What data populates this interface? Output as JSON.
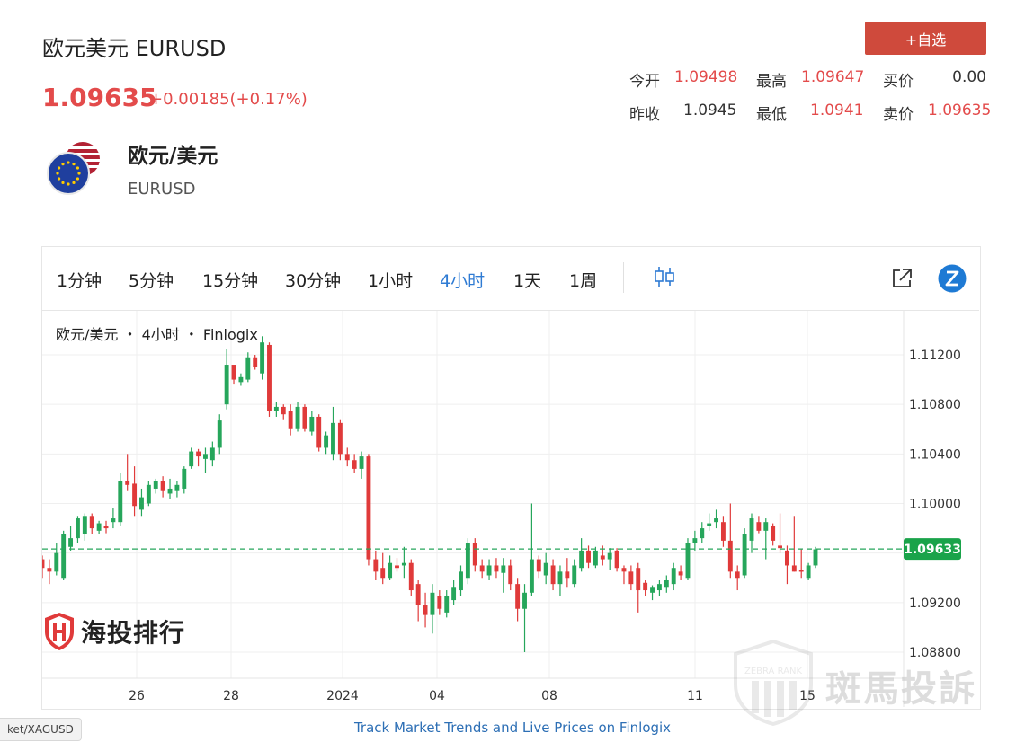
{
  "header": {
    "title": "欧元美元 EURUSD",
    "price": "1.09635",
    "change": "+0.00185(+0.17%)",
    "add_watchlist_label": "+自选"
  },
  "quote": {
    "open_label": "今开",
    "open_value": "1.09498",
    "high_label": "最高",
    "high_value": "1.09647",
    "bid_label": "买价",
    "bid_value": "0.00",
    "prev_close_label": "昨收",
    "prev_close_value": "1.0945",
    "low_label": "最低",
    "low_value": "1.0941",
    "ask_label": "卖价",
    "ask_value": "1.09635"
  },
  "instrument": {
    "name": "欧元/美元",
    "code": "EURUSD"
  },
  "toolbar": {
    "timeframes": [
      "1分钟",
      "5分钟",
      "15分钟",
      "30分钟",
      "1小时",
      "4小时",
      "1天",
      "1周"
    ],
    "active_timeframe": "4小时"
  },
  "chart_caption": "欧元/美元 ・ 4小时 ・ Finlogix",
  "watermark_left": "海投排行",
  "watermark_right": "斑馬投訴",
  "watermark_badge": "ZEBRA RANK",
  "footer_link": "Track Market Trends and Live Prices on Finlogix",
  "corner_tag": "ket/XAGUSD",
  "colors": {
    "up": "#26a65b",
    "down": "#e03a3a",
    "accent": "#2f7bd3",
    "price_red": "#e34b4b"
  },
  "chart_data": {
    "type": "candlestick",
    "title": "欧元/美元 ・ 4小时 ・ Finlogix",
    "x_tick_labels": [
      "26",
      "28",
      "2024",
      "04",
      "08",
      "11",
      "15"
    ],
    "y_tick_labels": [
      "1.11200",
      "1.10800",
      "1.10400",
      "1.10000",
      "1.09600",
      "1.09200",
      "1.08800"
    ],
    "y_ticks": [
      1.112,
      1.108,
      1.104,
      1.1,
      1.096,
      1.092,
      1.088
    ],
    "ylim": [
      1.0862,
      1.1175
    ],
    "last_price": 1.09633,
    "last_price_label": "1.09633",
    "grid": true,
    "candles": [
      {
        "o": 1.0955,
        "h": 1.0958,
        "l": 1.094,
        "c": 1.0948
      },
      {
        "o": 1.0948,
        "h": 1.0955,
        "l": 1.0935,
        "c": 1.0945
      },
      {
        "o": 1.0945,
        "h": 1.0968,
        "l": 1.0942,
        "c": 1.096
      },
      {
        "o": 1.094,
        "h": 1.0978,
        "l": 1.0938,
        "c": 1.0975
      },
      {
        "o": 1.0965,
        "h": 1.0982,
        "l": 1.0962,
        "c": 1.0972
      },
      {
        "o": 1.0972,
        "h": 1.099,
        "l": 1.0968,
        "c": 1.0988
      },
      {
        "o": 1.0975,
        "h": 1.0992,
        "l": 1.097,
        "c": 1.099
      },
      {
        "o": 1.099,
        "h": 1.0992,
        "l": 1.0975,
        "c": 1.098
      },
      {
        "o": 1.0978,
        "h": 1.0986,
        "l": 1.0975,
        "c": 1.0984
      },
      {
        "o": 1.0982,
        "h": 1.0986,
        "l": 1.0976,
        "c": 1.098
      },
      {
        "o": 1.0985,
        "h": 1.0996,
        "l": 1.098,
        "c": 1.0988
      },
      {
        "o": 1.0985,
        "h": 1.1025,
        "l": 1.0982,
        "c": 1.1018
      },
      {
        "o": 1.1018,
        "h": 1.104,
        "l": 1.101,
        "c": 1.1015
      },
      {
        "o": 1.1016,
        "h": 1.103,
        "l": 1.099,
        "c": 1.0998
      },
      {
        "o": 1.0995,
        "h": 1.1012,
        "l": 1.099,
        "c": 1.1005
      },
      {
        "o": 1.1,
        "h": 1.1018,
        "l": 1.0998,
        "c": 1.1015
      },
      {
        "o": 1.1012,
        "h": 1.102,
        "l": 1.1008,
        "c": 1.1018
      },
      {
        "o": 1.1018,
        "h": 1.1022,
        "l": 1.1005,
        "c": 1.101
      },
      {
        "o": 1.1008,
        "h": 1.102,
        "l": 1.1004,
        "c": 1.1012
      },
      {
        "o": 1.101,
        "h": 1.1018,
        "l": 1.1005,
        "c": 1.1015
      },
      {
        "o": 1.1012,
        "h": 1.103,
        "l": 1.1008,
        "c": 1.1028
      },
      {
        "o": 1.103,
        "h": 1.1045,
        "l": 1.1028,
        "c": 1.1042
      },
      {
        "o": 1.1042,
        "h": 1.1044,
        "l": 1.103,
        "c": 1.1038
      },
      {
        "o": 1.1036,
        "h": 1.1045,
        "l": 1.1025,
        "c": 1.104
      },
      {
        "o": 1.1035,
        "h": 1.105,
        "l": 1.103,
        "c": 1.1045
      },
      {
        "o": 1.1045,
        "h": 1.1072,
        "l": 1.104,
        "c": 1.1067
      },
      {
        "o": 1.108,
        "h": 1.1125,
        "l": 1.1076,
        "c": 1.1112
      },
      {
        "o": 1.1112,
        "h": 1.111,
        "l": 1.1096,
        "c": 1.11
      },
      {
        "o": 1.1098,
        "h": 1.1105,
        "l": 1.1095,
        "c": 1.1102
      },
      {
        "o": 1.11,
        "h": 1.1122,
        "l": 1.1098,
        "c": 1.1118
      },
      {
        "o": 1.1118,
        "h": 1.112,
        "l": 1.1108,
        "c": 1.111
      },
      {
        "o": 1.1105,
        "h": 1.1135,
        "l": 1.11,
        "c": 1.113
      },
      {
        "o": 1.1128,
        "h": 1.113,
        "l": 1.107,
        "c": 1.1075
      },
      {
        "o": 1.1075,
        "h": 1.1082,
        "l": 1.107,
        "c": 1.1078
      },
      {
        "o": 1.1078,
        "h": 1.108,
        "l": 1.1068,
        "c": 1.1072
      },
      {
        "o": 1.1075,
        "h": 1.108,
        "l": 1.1055,
        "c": 1.106
      },
      {
        "o": 1.106,
        "h": 1.1082,
        "l": 1.1058,
        "c": 1.1078
      },
      {
        "o": 1.1078,
        "h": 1.108,
        "l": 1.1058,
        "c": 1.106
      },
      {
        "o": 1.1058,
        "h": 1.1075,
        "l": 1.1055,
        "c": 1.107
      },
      {
        "o": 1.107,
        "h": 1.1072,
        "l": 1.1042,
        "c": 1.1045
      },
      {
        "o": 1.1045,
        "h": 1.1058,
        "l": 1.104,
        "c": 1.1055
      },
      {
        "o": 1.104,
        "h": 1.1078,
        "l": 1.1035,
        "c": 1.1065
      },
      {
        "o": 1.1065,
        "h": 1.1068,
        "l": 1.1035,
        "c": 1.104
      },
      {
        "o": 1.104,
        "h": 1.1045,
        "l": 1.103,
        "c": 1.1035
      },
      {
        "o": 1.1035,
        "h": 1.104,
        "l": 1.1025,
        "c": 1.1028
      },
      {
        "o": 1.1028,
        "h": 1.1042,
        "l": 1.102,
        "c": 1.1038
      },
      {
        "o": 1.1038,
        "h": 1.104,
        "l": 1.095,
        "c": 1.0955
      },
      {
        "o": 1.0955,
        "h": 1.0962,
        "l": 1.0938,
        "c": 1.0945
      },
      {
        "o": 1.0948,
        "h": 1.096,
        "l": 1.0935,
        "c": 1.094
      },
      {
        "o": 1.094,
        "h": 1.0958,
        "l": 1.0938,
        "c": 1.0952
      },
      {
        "o": 1.095,
        "h": 1.0956,
        "l": 1.0945,
        "c": 1.0948
      },
      {
        "o": 1.095,
        "h": 1.0965,
        "l": 1.094,
        "c": 1.0952
      },
      {
        "o": 1.0952,
        "h": 1.0955,
        "l": 1.0925,
        "c": 1.093
      },
      {
        "o": 1.0935,
        "h": 1.0938,
        "l": 1.0905,
        "c": 1.0918
      },
      {
        "o": 1.0918,
        "h": 1.0928,
        "l": 1.09,
        "c": 1.091
      },
      {
        "o": 1.091,
        "h": 1.0935,
        "l": 1.0895,
        "c": 1.0928
      },
      {
        "o": 1.0925,
        "h": 1.093,
        "l": 1.091,
        "c": 1.0915
      },
      {
        "o": 1.0912,
        "h": 1.093,
        "l": 1.0908,
        "c": 1.0925
      },
      {
        "o": 1.0922,
        "h": 1.0938,
        "l": 1.0918,
        "c": 1.0932
      },
      {
        "o": 1.093,
        "h": 1.095,
        "l": 1.0925,
        "c": 1.0945
      },
      {
        "o": 1.094,
        "h": 1.0972,
        "l": 1.0935,
        "c": 1.0968
      },
      {
        "o": 1.0968,
        "h": 1.0972,
        "l": 1.0945,
        "c": 1.095
      },
      {
        "o": 1.095,
        "h": 1.0955,
        "l": 1.094,
        "c": 1.0945
      },
      {
        "o": 1.0942,
        "h": 1.0955,
        "l": 1.0938,
        "c": 1.095
      },
      {
        "o": 1.095,
        "h": 1.0956,
        "l": 1.094,
        "c": 1.0945
      },
      {
        "o": 1.0944,
        "h": 1.0956,
        "l": 1.0928,
        "c": 1.095
      },
      {
        "o": 1.095,
        "h": 1.0955,
        "l": 1.093,
        "c": 1.0935
      },
      {
        "o": 1.0935,
        "h": 1.094,
        "l": 1.0905,
        "c": 1.0915
      },
      {
        "o": 1.0915,
        "h": 1.0935,
        "l": 1.088,
        "c": 1.0928
      },
      {
        "o": 1.0928,
        "h": 1.1,
        "l": 1.0925,
        "c": 1.0955
      },
      {
        "o": 1.0955,
        "h": 1.0958,
        "l": 1.094,
        "c": 1.0945
      },
      {
        "o": 1.0942,
        "h": 1.096,
        "l": 1.0935,
        "c": 1.0952
      },
      {
        "o": 1.095,
        "h": 1.0955,
        "l": 1.093,
        "c": 1.0935
      },
      {
        "o": 1.0935,
        "h": 1.095,
        "l": 1.0925,
        "c": 1.0945
      },
      {
        "o": 1.0945,
        "h": 1.0956,
        "l": 1.0932,
        "c": 1.094
      },
      {
        "o": 1.0935,
        "h": 1.0955,
        "l": 1.0932,
        "c": 1.095
      },
      {
        "o": 1.0948,
        "h": 1.0972,
        "l": 1.0945,
        "c": 1.0962
      },
      {
        "o": 1.0962,
        "h": 1.0966,
        "l": 1.0948,
        "c": 1.0952
      },
      {
        "o": 1.095,
        "h": 1.0965,
        "l": 1.0948,
        "c": 1.0962
      },
      {
        "o": 1.0958,
        "h": 1.0966,
        "l": 1.095,
        "c": 1.0955
      },
      {
        "o": 1.0955,
        "h": 1.0964,
        "l": 1.0946,
        "c": 1.096
      },
      {
        "o": 1.0962,
        "h": 1.0964,
        "l": 1.0945,
        "c": 1.0948
      },
      {
        "o": 1.0948,
        "h": 1.095,
        "l": 1.0935,
        "c": 1.0945
      },
      {
        "o": 1.0945,
        "h": 1.095,
        "l": 1.093,
        "c": 1.0935
      },
      {
        "o": 1.0948,
        "h": 1.0952,
        "l": 1.0912,
        "c": 1.093
      },
      {
        "o": 1.0936,
        "h": 1.0938,
        "l": 1.0925,
        "c": 1.093
      },
      {
        "o": 1.0928,
        "h": 1.0934,
        "l": 1.0922,
        "c": 1.0932
      },
      {
        "o": 1.093,
        "h": 1.0938,
        "l": 1.0925,
        "c": 1.0935
      },
      {
        "o": 1.0932,
        "h": 1.0942,
        "l": 1.0928,
        "c": 1.0938
      },
      {
        "o": 1.0935,
        "h": 1.0952,
        "l": 1.093,
        "c": 1.0948
      },
      {
        "o": 1.0945,
        "h": 1.095,
        "l": 1.0938,
        "c": 1.0942
      },
      {
        "o": 1.094,
        "h": 1.0972,
        "l": 1.0938,
        "c": 1.0968
      },
      {
        "o": 1.0968,
        "h": 1.0978,
        "l": 1.0962,
        "c": 1.0972
      },
      {
        "o": 1.0972,
        "h": 1.0985,
        "l": 1.0968,
        "c": 1.098
      },
      {
        "o": 1.0982,
        "h": 1.0992,
        "l": 1.0978,
        "c": 1.0984
      },
      {
        "o": 1.0985,
        "h": 1.0995,
        "l": 1.098,
        "c": 1.0988
      },
      {
        "o": 1.0985,
        "h": 1.099,
        "l": 1.0965,
        "c": 1.097
      },
      {
        "o": 1.097,
        "h": 1.1,
        "l": 1.094,
        "c": 1.0945
      },
      {
        "o": 1.0945,
        "h": 1.095,
        "l": 1.093,
        "c": 1.094
      },
      {
        "o": 1.0942,
        "h": 1.098,
        "l": 1.094,
        "c": 1.0975
      },
      {
        "o": 1.097,
        "h": 1.0992,
        "l": 1.096,
        "c": 1.0988
      },
      {
        "o": 1.0985,
        "h": 1.099,
        "l": 1.0976,
        "c": 1.0978
      },
      {
        "o": 1.0978,
        "h": 1.0988,
        "l": 1.0955,
        "c": 1.0985
      },
      {
        "o": 1.0982,
        "h": 1.0984,
        "l": 1.0966,
        "c": 1.097
      },
      {
        "o": 1.0966,
        "h": 1.0992,
        "l": 1.096,
        "c": 1.0964
      },
      {
        "o": 1.0962,
        "h": 1.0966,
        "l": 1.0935,
        "c": 1.095
      },
      {
        "o": 1.095,
        "h": 1.099,
        "l": 1.0945,
        "c": 1.0945
      },
      {
        "o": 1.0946,
        "h": 1.0963,
        "l": 1.094,
        "c": 1.0945
      },
      {
        "o": 1.094,
        "h": 1.0952,
        "l": 1.0938,
        "c": 1.095
      },
      {
        "o": 1.095,
        "h": 1.0965,
        "l": 1.0948,
        "c": 1.0963
      }
    ]
  }
}
